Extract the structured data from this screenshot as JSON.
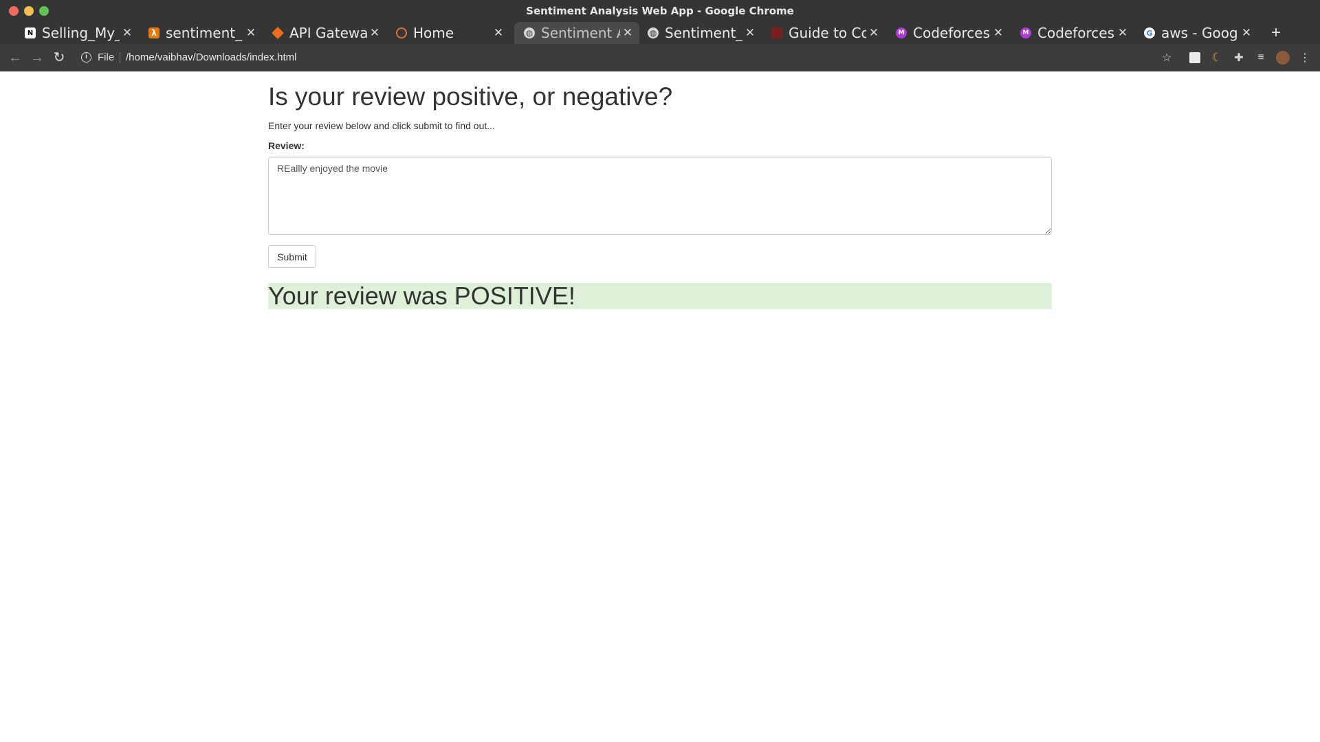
{
  "window": {
    "title": "Sentiment Analysis Web App - Google Chrome"
  },
  "tabs": [
    {
      "label": "Selling_My_",
      "icon": "notion-icon",
      "active": false
    },
    {
      "label": "sentiment_l",
      "icon": "aws-lambda-icon",
      "active": false
    },
    {
      "label": "API Gateway",
      "icon": "api-gateway-icon",
      "active": false
    },
    {
      "label": "Home",
      "icon": "jupyter-icon",
      "active": false
    },
    {
      "label": "Sentiment A",
      "icon": "globe-icon",
      "active": true
    },
    {
      "label": "Sentiment_A",
      "icon": "globe-icon",
      "active": false
    },
    {
      "label": "Guide to Co",
      "icon": "bookmark-icon",
      "active": false
    },
    {
      "label": "Codeforces",
      "icon": "medium-icon",
      "active": false
    },
    {
      "label": "Codeforces",
      "icon": "medium-icon",
      "active": false
    },
    {
      "label": "aws - Google",
      "icon": "google-icon",
      "active": false
    }
  ],
  "toolbar": {
    "scheme": "File",
    "url": "/home/vaibhav/Downloads/index.html"
  },
  "page": {
    "heading": "Is your review positive, or negative?",
    "instructions": "Enter your review below and click submit to find out...",
    "review_label": "Review:",
    "review_value": "REallly enjoyed the movie",
    "submit_label": "Submit",
    "result_text": "Your review was POSITIVE!"
  },
  "colors": {
    "result_background": "#dff0d8",
    "chrome_background": "#353535"
  }
}
